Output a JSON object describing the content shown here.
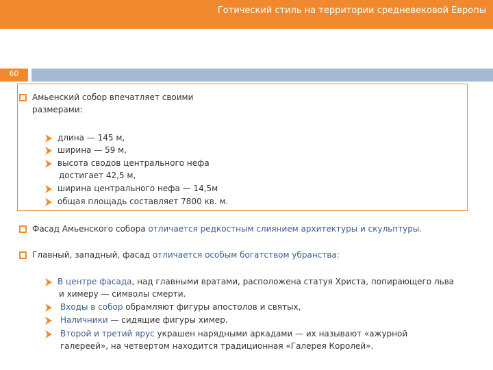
{
  "header": {
    "title": "Готический стиль на территории средневековой Европы"
  },
  "slide_number": "60",
  "colors": {
    "accent": "#f0892d",
    "bar": "#a6b9d2",
    "link": "#3a5b8c"
  },
  "section1": {
    "intro_line1": "Амьенский собор впечатляет своими",
    "intro_line2": "размерами:",
    "items": [
      "длина — 145 м,",
      "ширина — 59 м,",
      "высота сводов центрального нефа",
      "ширина центрального нефа — 14,5м",
      "общая площадь составляет 7800 кв. м."
    ],
    "item3_cont": "достигает 42,5 м,"
  },
  "section2": {
    "part1": "Фасад Амьенского собора",
    "part2": " отличается редкостным слиянием архитектуры и скульптуры."
  },
  "section3": {
    "part1": "Главный, западный, фасад",
    "part2": " отличается особым богатством убранства:",
    "items": [
      {
        "a": "В центре фасада",
        "b": ", над главными вратами, расположена статуя Христа, попирающего льва",
        "c": "и химеру — символы смерти."
      },
      {
        "a": "Входы в собор",
        "b": " обрамляют фигуры апостолов и святых,"
      },
      {
        "a": "Наличники",
        "b": " — сидящие фигуры химер."
      },
      {
        "a": "Второй и третий ярус",
        "b": " украшен нарядными аркадами — их называют «ажурной",
        "c": "галереей», на четвертом находится традиционная «Галерея Королей»."
      }
    ]
  }
}
